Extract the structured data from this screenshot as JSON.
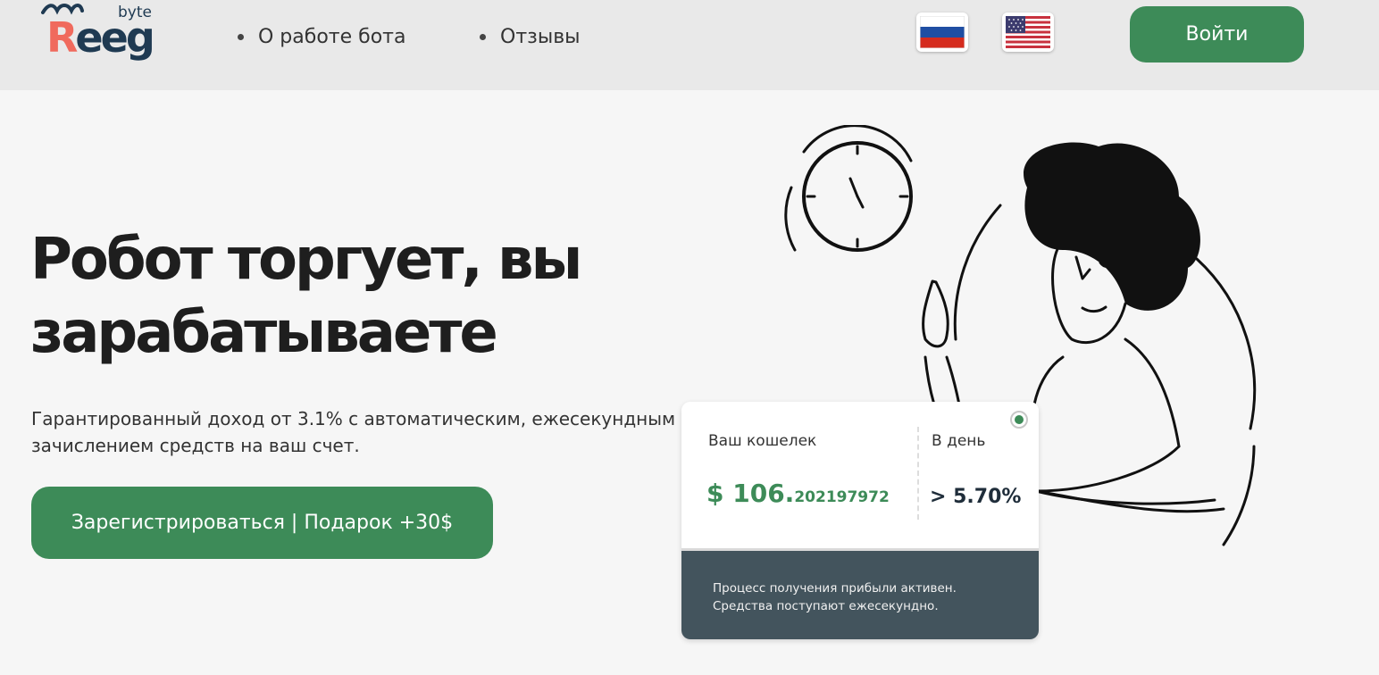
{
  "header": {
    "logo": {
      "main": "Reeg",
      "main_first": "R",
      "main_rest": "eeg",
      "sub": "byte"
    },
    "nav": [
      {
        "label": "О работе бота"
      },
      {
        "label": "Отзывы"
      }
    ],
    "languages": [
      {
        "code": "ru",
        "icon": "russia-flag-icon"
      },
      {
        "code": "en",
        "icon": "usa-flag-icon"
      }
    ],
    "login_label": "Войти"
  },
  "hero": {
    "title": "Робот торгует, вы зарабатываете",
    "description": "Гарантированный доход от 3.1% с автоматическим, ежесекундным зачислением средств на ваш счет.",
    "register_label": "Зарегистрироваться | Подарок +30$"
  },
  "wallet": {
    "label": "Ваш кошелек",
    "amount_main": "$ 106.",
    "amount_fraction": "202197972",
    "per_day_label": "В день",
    "per_day_value": "> 5.70%",
    "note": "Процесс получения прибыли активен. Средства поступают ежесекундно."
  },
  "colors": {
    "accent_green": "#3d8b58",
    "logo_coral": "#f06a5d",
    "logo_navy": "#1f3a52",
    "card_footer": "#43545d",
    "header_bg": "#e9e9e9",
    "page_bg": "#f6f6f6"
  }
}
